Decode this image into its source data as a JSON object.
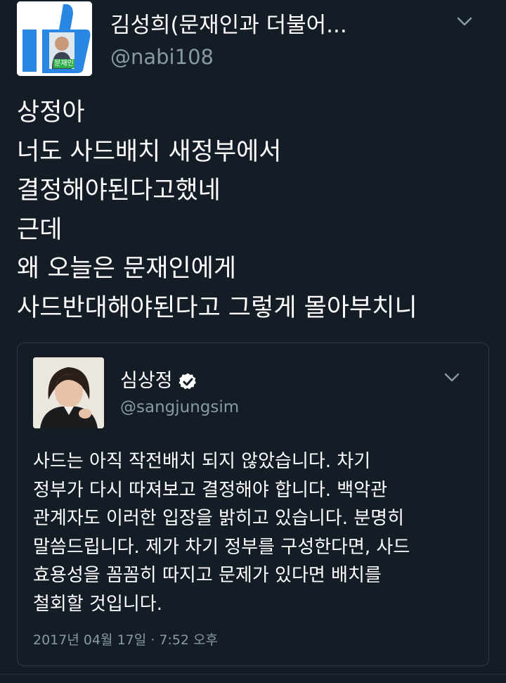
{
  "tweet": {
    "display_name": "김성희(문재인과 더불어...",
    "handle": "@nabi108",
    "lines": [
      "상정아",
      "너도 사드배치 새정부에서",
      "결정해야된다고했네",
      "근데",
      "왜 오늘은 문재인에게",
      "사드반대해야된다고 그렇게 몰아부치니"
    ],
    "avatar_badge_text": "문재인"
  },
  "quoted_tweet": {
    "display_name": "심상정",
    "handle": "@sangjungsim",
    "verified": true,
    "lines": [
      "사드는 아직 작전배치 되지 않았습니다. 차기",
      "정부가 다시 따져보고 결정해야 합니다. 백악관",
      "관계자도 이러한 입장을 밝히고 있습니다. 분명히",
      "말씀드립니다. 제가 차기 정부를 구성한다면, 사드",
      "효용성을 꼼꼼히 따지고 문제가 있다면 배치를",
      "철회할 것입니다."
    ],
    "timestamp": "2017년 04월 17일 · 7:52 오후"
  },
  "icons": {
    "menu": "chevron-down-icon",
    "verified": "verified-badge-icon"
  },
  "colors": {
    "background": "#141d26",
    "secondary_text": "#8899a6",
    "border": "#2b3a47",
    "avatar_blue": "#2a86e3"
  }
}
